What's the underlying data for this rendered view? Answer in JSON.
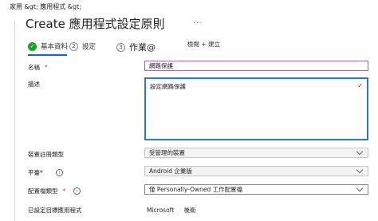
{
  "header": {
    "breadcrumb": "家用 &gt;  應用程式 &gt;",
    "title": "Create 應用程式設定原則",
    "more": "..."
  },
  "steps": [
    {
      "num": "✓",
      "label": "基本資料",
      "state": "done"
    },
    {
      "num": "2",
      "label": "設定",
      "state": "todo"
    },
    {
      "num": "3",
      "label": "作業@",
      "state": "todo"
    },
    {
      "num": "",
      "label": "檢閱 + 建立",
      "state": "todo"
    }
  ],
  "form": {
    "name": {
      "label": "名稱",
      "required_mark": "*",
      "value": "網路保護"
    },
    "description": {
      "label": "描述",
      "value": "設定網路保護"
    },
    "device_enrollment_type": {
      "label": "裝置註冊類型",
      "value": "受管理的裝置"
    },
    "platform": {
      "label": "平臺*",
      "value": "Android 企業版"
    },
    "profile_type": {
      "label": "配置檔類型",
      "required_mark": "*",
      "value": "僅 Personally-Owned 工作配置檔"
    },
    "targeted_app": {
      "label": "已設定目標應用程式",
      "values": [
        "Microsoft",
        "後衛"
      ]
    }
  },
  "colors": {
    "accent": "#0f6cbd",
    "step_done": "#1ea31e",
    "required": "#c4314b",
    "focus_border": "#2b79c2"
  }
}
